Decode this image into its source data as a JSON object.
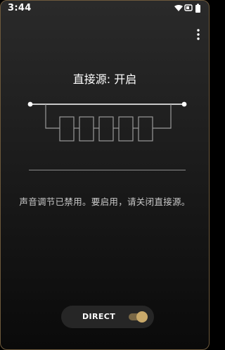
{
  "status_bar": {
    "time": "3:44",
    "icons": [
      "wifi-icon",
      "battery-saver-icon",
      "battery-icon"
    ]
  },
  "toolbar": {
    "menu_icon": "more-vert-icon"
  },
  "main": {
    "title": "直接源: 开启",
    "message": "声音调节已禁用。要启用，请关闭直接源。",
    "diagram_icon": "direct-source-bypass-diagram"
  },
  "bottom": {
    "direct_label": "DIRECT",
    "direct_enabled": true
  },
  "colors": {
    "accent": "#c9a96a",
    "accent_track": "#7a6846",
    "frame": "#6e5a3c",
    "text_primary": "#ffffff",
    "text_secondary": "#c9c9c9"
  }
}
